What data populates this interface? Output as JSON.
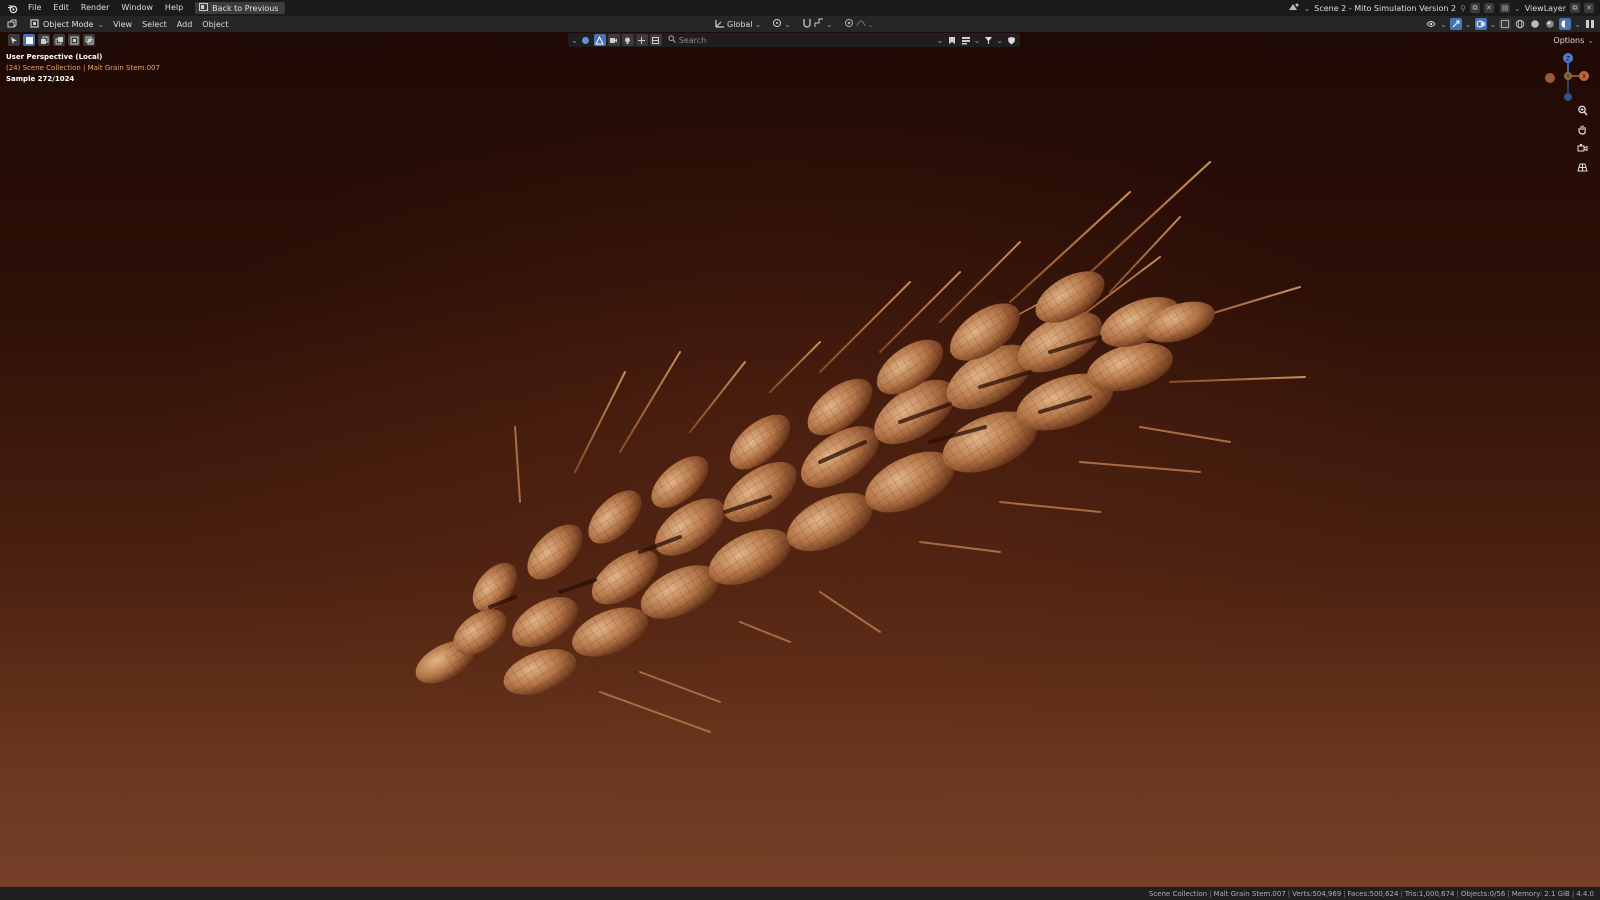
{
  "menu": {
    "file": "File",
    "edit": "Edit",
    "render": "Render",
    "window": "Window",
    "help": "Help",
    "back_to_previous": "Back to Previous"
  },
  "top_right": {
    "scene": "Scene 2 - Mito Simulation Version 2",
    "view_layer": "ViewLayer"
  },
  "header": {
    "mode": "Object Mode",
    "view": "View",
    "select": "Select",
    "add": "Add",
    "object": "Object",
    "orientation": "Global",
    "options": "Options"
  },
  "outliner": {
    "search_placeholder": "Search"
  },
  "viewport": {
    "perspective": "User Perspective (Local)",
    "collection": "(24) Scene Collection | Malt Grain Stem.007",
    "sample": "Sample 272/1024"
  },
  "gizmo": {
    "x": "X",
    "y": "Y",
    "z": "Z"
  },
  "status": {
    "collection": "Scene Collection",
    "object": "Malt Grain Stem.007",
    "verts": "Verts:504,969",
    "faces": "Faces:500,624",
    "tris": "Tris:1,000,674",
    "objects": "Objects:0/56",
    "memory": "Memory: 2.1 GiB",
    "version": "4.4.0"
  },
  "colors": {
    "accent": "#4772b3",
    "collection_text": "#e8a36a",
    "viewport_top": "#200a05",
    "viewport_bottom": "#754027",
    "grain": "#a8683c"
  }
}
